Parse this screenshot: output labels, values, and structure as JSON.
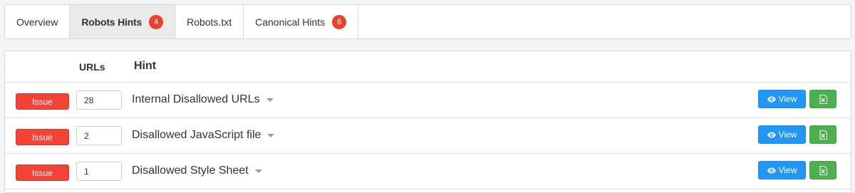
{
  "tabs": [
    {
      "label": "Overview",
      "count": null,
      "active": false
    },
    {
      "label": "Robots Hints",
      "count": "4",
      "active": true
    },
    {
      "label": "Robots.txt",
      "count": null,
      "active": false
    },
    {
      "label": "Canonical Hints",
      "count": "6",
      "active": false
    }
  ],
  "table": {
    "header_urls": "URLs",
    "header_hint": "Hint",
    "rows": [
      {
        "status": "Issue",
        "urls": "28",
        "hint": "Internal Disallowed URLs",
        "view_label": "View"
      },
      {
        "status": "Issue",
        "urls": "2",
        "hint": "Disallowed JavaScript file",
        "view_label": "View"
      },
      {
        "status": "Issue",
        "urls": "1",
        "hint": "Disallowed Style Sheet",
        "view_label": "View"
      }
    ]
  },
  "icons": {
    "view": "eye-icon",
    "export": "excel-file-icon",
    "dropdown": "caret-down-icon"
  },
  "colors": {
    "issue": "#f34336",
    "count_badge": "#e8412d",
    "view_button": "#2196f3",
    "export_button": "#4caf50",
    "active_tab": "#eaeaea"
  }
}
